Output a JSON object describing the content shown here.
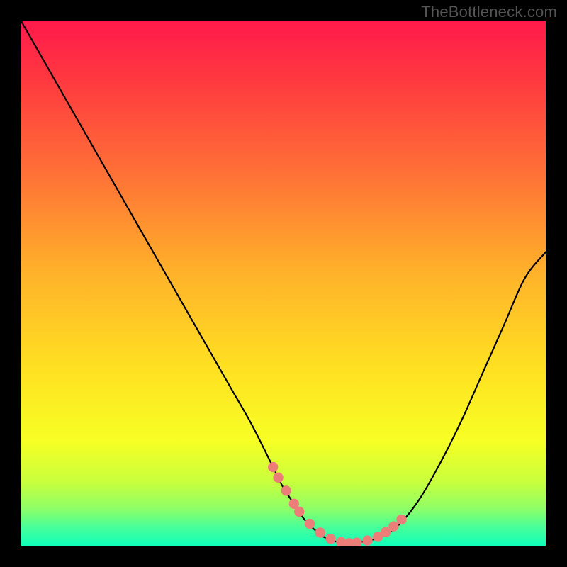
{
  "watermark": "TheBottleneck.com",
  "colors": {
    "frame_bg": "#000000",
    "curve": "#000000",
    "marker_fill": "#ed7d78",
    "marker_stroke": "#ed7d78",
    "gradient_stops": [
      {
        "pos": 0.0,
        "color": "#ff1a4b"
      },
      {
        "pos": 0.12,
        "color": "#ff3b3f"
      },
      {
        "pos": 0.3,
        "color": "#ff7436"
      },
      {
        "pos": 0.48,
        "color": "#ffb22a"
      },
      {
        "pos": 0.66,
        "color": "#ffe022"
      },
      {
        "pos": 0.8,
        "color": "#f7ff24"
      },
      {
        "pos": 0.88,
        "color": "#c7ff3e"
      },
      {
        "pos": 0.93,
        "color": "#8dff68"
      },
      {
        "pos": 0.965,
        "color": "#47ff9a"
      },
      {
        "pos": 1.0,
        "color": "#11ffba"
      }
    ]
  },
  "chart_data": {
    "type": "line",
    "title": "",
    "xlabel": "",
    "ylabel": "",
    "xlim": [
      0,
      100
    ],
    "ylim": [
      0,
      100
    ],
    "grid": false,
    "legend": false,
    "series": [
      {
        "name": "bottleneck-curve",
        "x": [
          0,
          4,
          8,
          12,
          16,
          20,
          24,
          28,
          32,
          36,
          40,
          44,
          48,
          50,
          52,
          54,
          56,
          58,
          60,
          62,
          64,
          68,
          72,
          76,
          80,
          84,
          88,
          92,
          96,
          100
        ],
        "y": [
          100,
          93,
          86,
          79,
          72,
          65,
          58,
          51,
          44,
          37,
          30,
          23,
          15,
          11,
          8,
          5,
          3,
          1.5,
          0.8,
          0.5,
          0.6,
          1.5,
          4,
          9,
          16,
          24,
          33,
          42,
          51,
          56
        ]
      }
    ],
    "markers": {
      "name": "highlight-points",
      "x": [
        48,
        49,
        50.5,
        52,
        53,
        55,
        57,
        59,
        61,
        62.5,
        64,
        66,
        68,
        69.5,
        71,
        72.5
      ],
      "y": [
        15,
        13,
        10.5,
        8,
        6.5,
        4.2,
        2.5,
        1.3,
        0.7,
        0.5,
        0.6,
        1.0,
        1.7,
        2.6,
        3.7,
        5.0
      ]
    }
  }
}
